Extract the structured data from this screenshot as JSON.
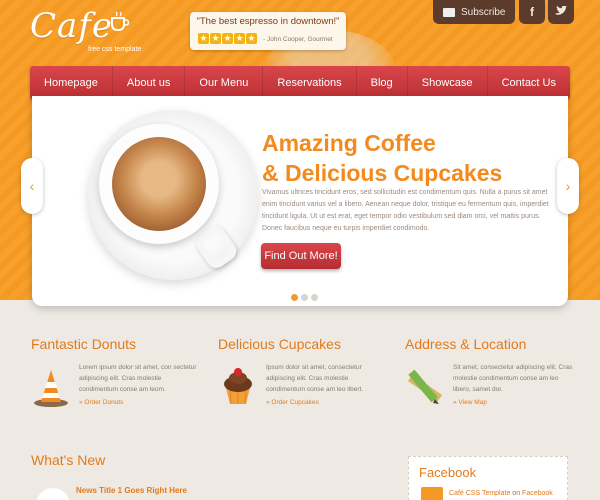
{
  "brand": {
    "logo_text": "Cafe",
    "tagline": "free css template"
  },
  "quote": {
    "text": "\"The best espresso in downtown!\"",
    "author": "- John Cooper, Gourmet",
    "stars": 5
  },
  "header_actions": {
    "subscribe_label": "Subscribe",
    "facebook_label": "f",
    "twitter_label": "t"
  },
  "nav": {
    "items": [
      "Homepage",
      "About us",
      "Our Menu",
      "Reservations",
      "Blog",
      "Showcase",
      "Contact Us"
    ]
  },
  "hero": {
    "title_line1": "Amazing Coffee",
    "title_line2": "& Delicious Cupcakes",
    "body": "Vivamus ultrices tincidunt eros, sed sollicitudin est condimentum quis. Nulla a purus sit amet enim tincidunt varius vel a libero. Aenean neque dolor, tristique eu fermentum quis, imperdiet tincidunt ligula. Ut ut est erat, eget tempor odio vestibulum sed diam orci, vel mattis purus. Donec faucibus neque eu turpis imperdiet condimodo.",
    "cta_label": "Find Out More!",
    "slide_count": 3,
    "active_slide": 1,
    "prev_icon": "chevron-left-icon",
    "next_icon": "chevron-right-icon"
  },
  "features": [
    {
      "title": "Fantastic Donuts",
      "text": "Lorem ipsum dolor sit amet, con sectetur adipiscing elit. Cras molestie condimentum conse am leom.",
      "link": "» Order Donuts",
      "icon": "traffic-cone-icon"
    },
    {
      "title": "Delicious Cupcakes",
      "text": "Ipsum dolor sit amet, consectetur adipiscing elit. Cras molestie condimentum conse am leo libert.",
      "link": "» Order Cupcakes",
      "icon": "cupcake-icon"
    },
    {
      "title": "Address & Location",
      "text": "Sit amet, consectetur adipiscing elit. Cras molestie condimentum conse am leo libero, samet dor.",
      "link": "» View Map",
      "icon": "pencil-ruler-icon"
    }
  ],
  "news": {
    "heading": "What's New",
    "first_title": "News Title 1 Goes Right Here"
  },
  "facebook": {
    "heading": "Facebook",
    "page_name": "Café CSS Template",
    "on_text": " on ",
    "platform": "Facebook"
  },
  "colors": {
    "orange": "#f49a24",
    "accent_text": "#e27a1c",
    "nav_red": "#c53a3e",
    "brown": "#5a3b2c"
  }
}
